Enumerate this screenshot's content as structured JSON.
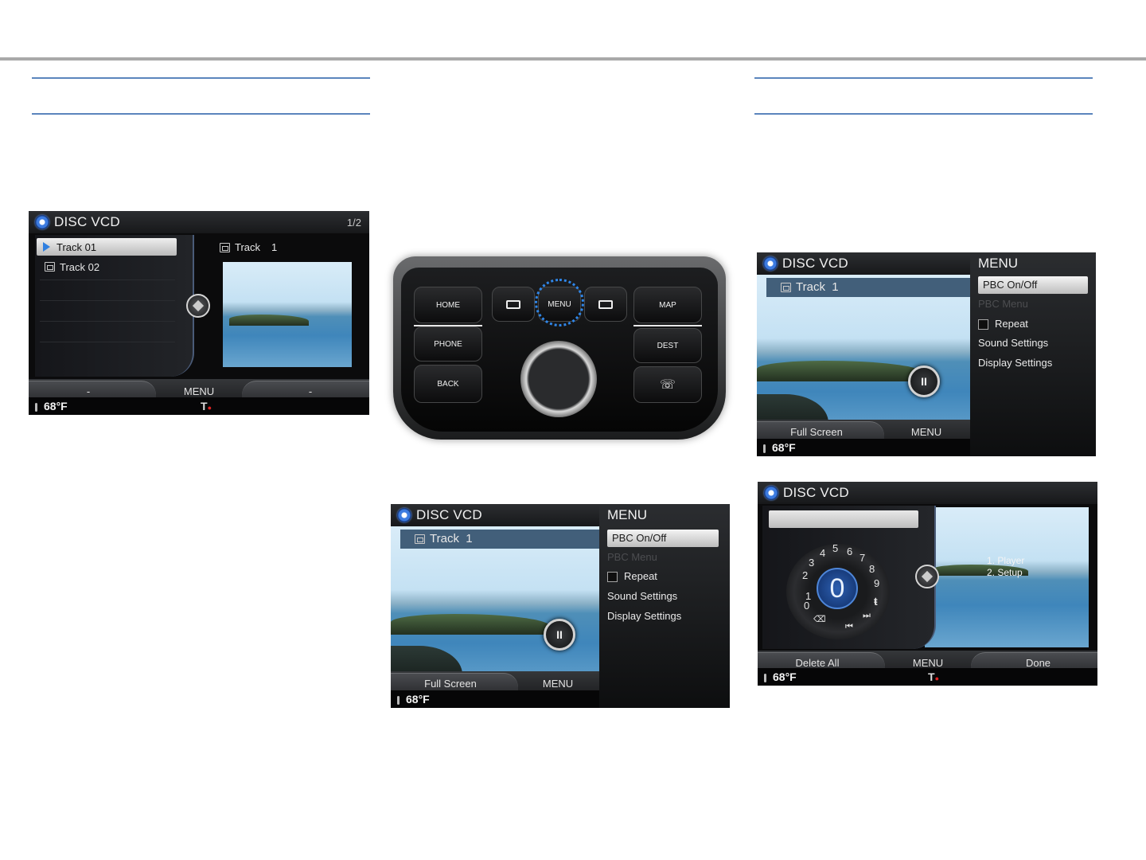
{
  "screen1": {
    "title": "DISC VCD",
    "page": "1/2",
    "tracks": [
      "Track 01",
      "Track 02"
    ],
    "now_playing": "Track",
    "now_playing_num": "1",
    "bottom": {
      "left": "-",
      "center": "MENU",
      "right": "-"
    },
    "temp": "68°F",
    "signal": "T"
  },
  "console": {
    "buttons": {
      "home": "HOME",
      "menu": "MENU",
      "map": "MAP",
      "phone": "PHONE",
      "dest": "DEST",
      "back": "BACK"
    }
  },
  "screen2": {
    "title": "DISC VCD",
    "track": "Track  1",
    "menu_title": "MENU",
    "menu_items": [
      "PBC On/Off",
      "PBC Menu",
      "Repeat",
      "Sound Settings",
      "Display Settings"
    ],
    "bottom": {
      "left": "Full Screen",
      "center": "MENU"
    },
    "temp": "68°F"
  },
  "screen3": {
    "title": "DISC VCD",
    "track": "Track  1",
    "menu_title": "MENU",
    "menu_items": [
      "PBC On/Off",
      "PBC Menu",
      "Repeat",
      "Sound Settings",
      "Display Settings"
    ],
    "bottom": {
      "left": "Full Screen",
      "center": "MENU"
    },
    "temp": "68°F"
  },
  "screen4": {
    "title": "DISC VCD",
    "dial_value": "0",
    "dial_numbers": [
      "1",
      "2",
      "3",
      "4",
      "5",
      "6",
      "7",
      "8",
      "9",
      "0"
    ],
    "options": [
      "1. Player",
      "2. Setup"
    ],
    "bottom": {
      "left": "Delete All",
      "center": "MENU",
      "right": "Done"
    },
    "temp": "68°F",
    "signal": "T"
  }
}
